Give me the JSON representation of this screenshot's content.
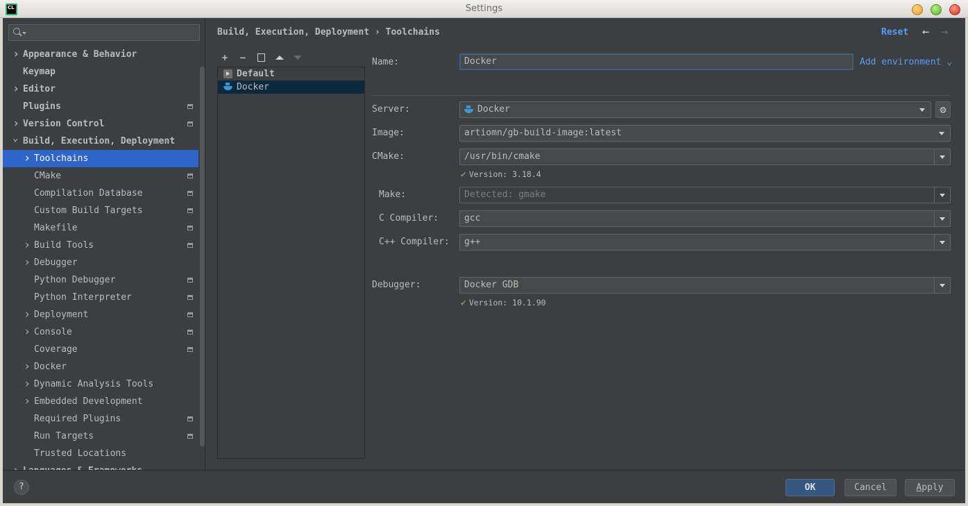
{
  "window": {
    "title": "Settings",
    "app_icon_text": "CL"
  },
  "sidebar": {
    "search_placeholder": "",
    "items": [
      {
        "label": "Appearance & Behavior",
        "chevron": "right",
        "bold": true,
        "indent": 0,
        "project": false
      },
      {
        "label": "Keymap",
        "chevron": "",
        "bold": true,
        "indent": 0,
        "project": false
      },
      {
        "label": "Editor",
        "chevron": "right",
        "bold": true,
        "indent": 0,
        "project": false
      },
      {
        "label": "Plugins",
        "chevron": "",
        "bold": true,
        "indent": 0,
        "project": true
      },
      {
        "label": "Version Control",
        "chevron": "right",
        "bold": true,
        "indent": 0,
        "project": true
      },
      {
        "label": "Build, Execution, Deployment",
        "chevron": "down",
        "bold": true,
        "indent": 0,
        "project": false
      },
      {
        "label": "Toolchains",
        "chevron": "right",
        "bold": false,
        "indent": 1,
        "project": false,
        "selected": true
      },
      {
        "label": "CMake",
        "chevron": "",
        "bold": false,
        "indent": 1,
        "project": true
      },
      {
        "label": "Compilation Database",
        "chevron": "",
        "bold": false,
        "indent": 1,
        "project": true
      },
      {
        "label": "Custom Build Targets",
        "chevron": "",
        "bold": false,
        "indent": 1,
        "project": true
      },
      {
        "label": "Makefile",
        "chevron": "",
        "bold": false,
        "indent": 1,
        "project": true
      },
      {
        "label": "Build Tools",
        "chevron": "right",
        "bold": false,
        "indent": 1,
        "project": true
      },
      {
        "label": "Debugger",
        "chevron": "right",
        "bold": false,
        "indent": 1,
        "project": false
      },
      {
        "label": "Python Debugger",
        "chevron": "",
        "bold": false,
        "indent": 1,
        "project": true
      },
      {
        "label": "Python Interpreter",
        "chevron": "",
        "bold": false,
        "indent": 1,
        "project": true
      },
      {
        "label": "Deployment",
        "chevron": "right",
        "bold": false,
        "indent": 1,
        "project": true
      },
      {
        "label": "Console",
        "chevron": "right",
        "bold": false,
        "indent": 1,
        "project": true
      },
      {
        "label": "Coverage",
        "chevron": "",
        "bold": false,
        "indent": 1,
        "project": true
      },
      {
        "label": "Docker",
        "chevron": "right",
        "bold": false,
        "indent": 1,
        "project": false
      },
      {
        "label": "Dynamic Analysis Tools",
        "chevron": "right",
        "bold": false,
        "indent": 1,
        "project": false
      },
      {
        "label": "Embedded Development",
        "chevron": "right",
        "bold": false,
        "indent": 1,
        "project": false
      },
      {
        "label": "Required Plugins",
        "chevron": "",
        "bold": false,
        "indent": 1,
        "project": true
      },
      {
        "label": "Run Targets",
        "chevron": "",
        "bold": false,
        "indent": 1,
        "project": true
      },
      {
        "label": "Trusted Locations",
        "chevron": "",
        "bold": false,
        "indent": 1,
        "project": false
      },
      {
        "label": "Languages & Frameworks",
        "chevron": "right",
        "bold": true,
        "indent": 0,
        "project": false
      }
    ]
  },
  "header": {
    "breadcrumb_parent": "Build, Execution, Deployment",
    "breadcrumb_sep": "›",
    "breadcrumb_current": "Toolchains",
    "reset": "Reset",
    "back_icon": "←",
    "forward_icon": "→"
  },
  "toolbar": {
    "add": "+",
    "remove": "−"
  },
  "toolchains": [
    {
      "name": "Default",
      "icon": "default-toolchain-icon",
      "bold": true,
      "selected": false
    },
    {
      "name": "Docker",
      "icon": "docker-icon",
      "bold": false,
      "selected": true
    }
  ],
  "form": {
    "name_label": "Name:",
    "name_value": "Docker",
    "add_environment": "Add environment",
    "server_label": "Server:",
    "server_value": "Docker",
    "image_label": "Image:",
    "image_value": "artiomn/gb-build-image:latest",
    "cmake_label": "CMake:",
    "cmake_value": "/usr/bin/cmake",
    "cmake_version": "Version: 3.18.4",
    "make_label": "Make:",
    "make_placeholder": "Detected: gmake",
    "c_label": "C Compiler:",
    "c_value": "gcc",
    "cpp_label": "C++ Compiler:",
    "cpp_value": "g++",
    "debugger_label": "Debugger:",
    "debugger_value": "Docker GDB",
    "debugger_version": "Version: 10.1.90"
  },
  "footer": {
    "help": "?",
    "ok": "OK",
    "cancel": "Cancel",
    "apply_first": "A",
    "apply_rest": "pply"
  },
  "colors": {
    "accent": "#2f65ca",
    "link": "#589df6",
    "check": "#59a869",
    "background": "#3c3f41"
  }
}
